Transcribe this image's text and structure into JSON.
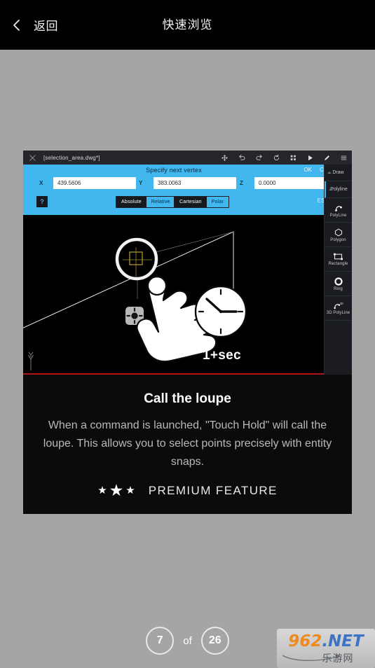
{
  "header": {
    "back_label": "返回",
    "title": "快速浏览",
    "back_icon": "chevron-left-icon"
  },
  "cad": {
    "filename": "[selection_area.dwg*]",
    "close_icon": "close-icon",
    "toolbar_icons": [
      "move-icon",
      "undo-icon",
      "redo-icon",
      "refresh-icon",
      "grid-icon",
      "play-icon",
      "pencil-icon",
      "hamburger-menu-icon"
    ],
    "command": {
      "prompt": "Specify next vertex",
      "ok_label": "OK",
      "cancel_label": "Cancel"
    },
    "coords": [
      {
        "label": "X",
        "value": "439.5606"
      },
      {
        "label": "Y",
        "value": "383.0063"
      },
      {
        "label": "Z",
        "value": "0.0000"
      }
    ],
    "help_label": "?",
    "toggle_coord": {
      "selected": "Absolute",
      "other": "Relative"
    },
    "toggle_system": {
      "selected": "Cartesian",
      "other": "Polar"
    },
    "esnap_label": "ESNAP",
    "hold_duration": "1+sec",
    "rail": {
      "sections": [
        {
          "label": "Draw",
          "expanded": false
        },
        {
          "label": "Polyline",
          "expanded": true
        }
      ],
      "tools": [
        {
          "label": "PolyLine",
          "icon": "polyline-icon"
        },
        {
          "label": "Polygon",
          "icon": "polygon-icon"
        },
        {
          "label": "Rectangle",
          "icon": "rectangle-icon"
        },
        {
          "label": "Ring",
          "icon": "ring-icon"
        },
        {
          "label": "3D PolyLine",
          "icon": "polyline-3d-icon"
        }
      ]
    }
  },
  "tutorial": {
    "title": "Call the loupe",
    "description": "When a command is launched, \"Touch Hold\" will call the loupe. This allows you to select points precisely with entity snaps.",
    "premium_label": "PREMIUM FEATURE",
    "stars": 3
  },
  "pager": {
    "current": "7",
    "of_label": "of",
    "total": "26"
  },
  "watermark": {
    "primary": "962",
    "secondary": ".NET",
    "chinese": "乐游网"
  },
  "colors": {
    "accent_blue": "#41b6ef",
    "page_background": "#a5a5a5",
    "card_background": "#0b0b0b",
    "header_background": "#000000",
    "snap_marker": "#b9a22e",
    "baseline_red": "#b41414"
  }
}
